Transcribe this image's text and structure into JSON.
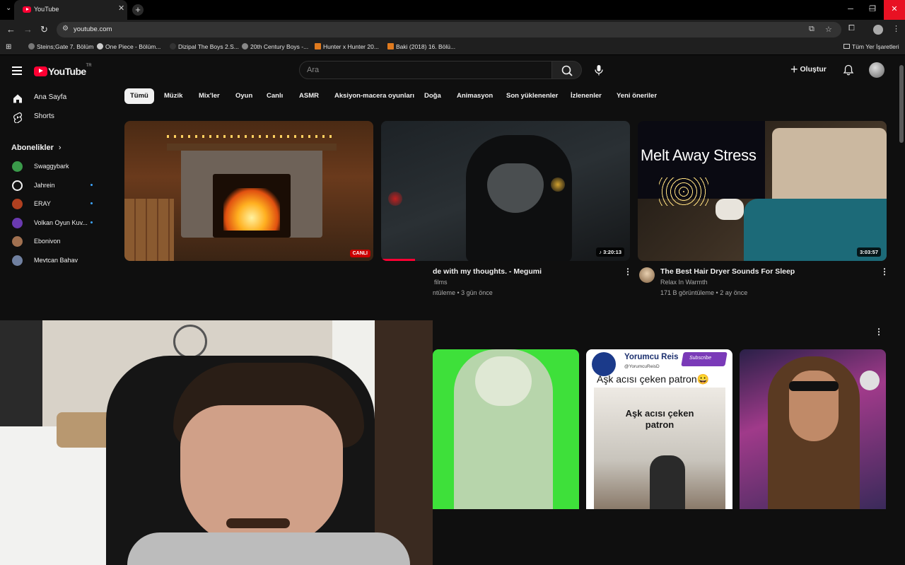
{
  "browser": {
    "tab_title": "YouTube",
    "url": "youtube.com",
    "bookmarks": [
      "Steins;Gate 7. Bölüm",
      "One Piece - Bölüm...",
      "Dizipal The Boys 2.S...",
      "20th Century Boys -...",
      "Hunter x Hunter 20...",
      "Baki (2018) 16. Bölü..."
    ],
    "all_bookmarks": "Tüm Yer İşaretleri"
  },
  "youtube": {
    "logo_text": "YouTube",
    "logo_region": "TR",
    "search_placeholder": "Ara",
    "create_label": "Oluştur",
    "sidebar": {
      "home": "Ana Sayfa",
      "shorts": "Shorts",
      "subscriptions_title": "Abonelikler",
      "subscriptions": [
        {
          "name": "Swaggybark",
          "dot": false,
          "color": "#3a9a4a"
        },
        {
          "name": "Jahrein",
          "dot": true,
          "color": "#f1f1f1"
        },
        {
          "name": "ERAY",
          "dot": true,
          "color": "#b04020"
        },
        {
          "name": "Volkan Oyun Kuv...",
          "dot": true,
          "color": "#6a3ab0"
        },
        {
          "name": "Ebonivon",
          "dot": false,
          "color": "#a07050"
        },
        {
          "name": "Mevtcan Bahav",
          "dot": false,
          "color": "#7080a0"
        }
      ]
    },
    "chips": [
      "Tümü",
      "Müzik",
      "Mix'ler",
      "Oyun",
      "Canlı",
      "ASMR",
      "Aksiyon-macera oyunları",
      "Doğa",
      "Animasyon",
      "Son yüklenenler",
      "İzlenenler",
      "Yeni öneriler"
    ],
    "videos": [
      {
        "badge": "CANLI"
      },
      {
        "duration": "3:20:13",
        "title": "de with my thoughts. - Megumi",
        "channel": "films",
        "meta": "ntüleme • 3 gün önce"
      },
      {
        "duration": "3:03:57",
        "title": "The Best Hair Dryer Sounds For Sleep",
        "channel": "Relax In Warmth",
        "meta": "171 B görüntüleme • 2 ay önce",
        "overlay_text": "Melt Away Stress"
      }
    ],
    "shorts_row": {
      "yorumcu_channel": "Yorumcu Reis",
      "yorumcu_handle": "@YorumcuReisD",
      "yorumcu_caption": "Aşk acısı çeken patron😀",
      "yorumcu_inner": "Aşk acısı çeken patron",
      "subscribe_sticker": "Subscribe"
    }
  }
}
